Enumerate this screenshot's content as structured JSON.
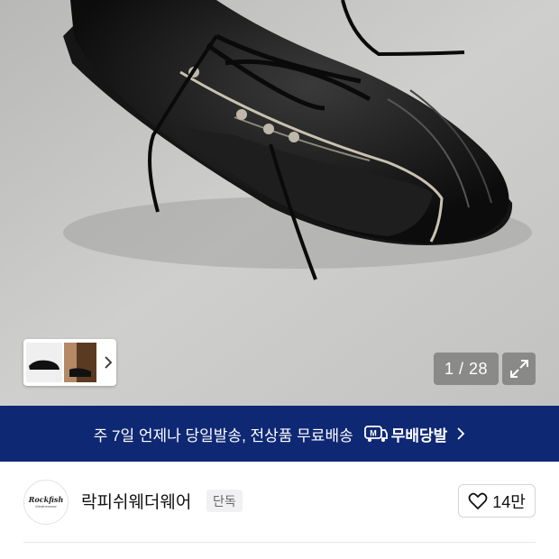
{
  "gallery": {
    "counter_text": "1 / 28",
    "current_index": 1,
    "total": 28,
    "expand_icon": "expand-icon",
    "thumbnail_next_icon": "chevron-right-icon"
  },
  "banner": {
    "text": "주 7일 언제나 당일발송, 전상품 무료배송",
    "badge_label": "무배당발",
    "badge_icon": "m-truck-icon",
    "chevron_icon": "chevron-right-icon",
    "background": "#0f2874"
  },
  "seller": {
    "logo_text": "Rockfish",
    "logo_subtext": "Weatherwear",
    "name": "락피쉬웨더웨어",
    "tag": "단독",
    "like_icon": "heart-icon",
    "like_count": "14만"
  }
}
